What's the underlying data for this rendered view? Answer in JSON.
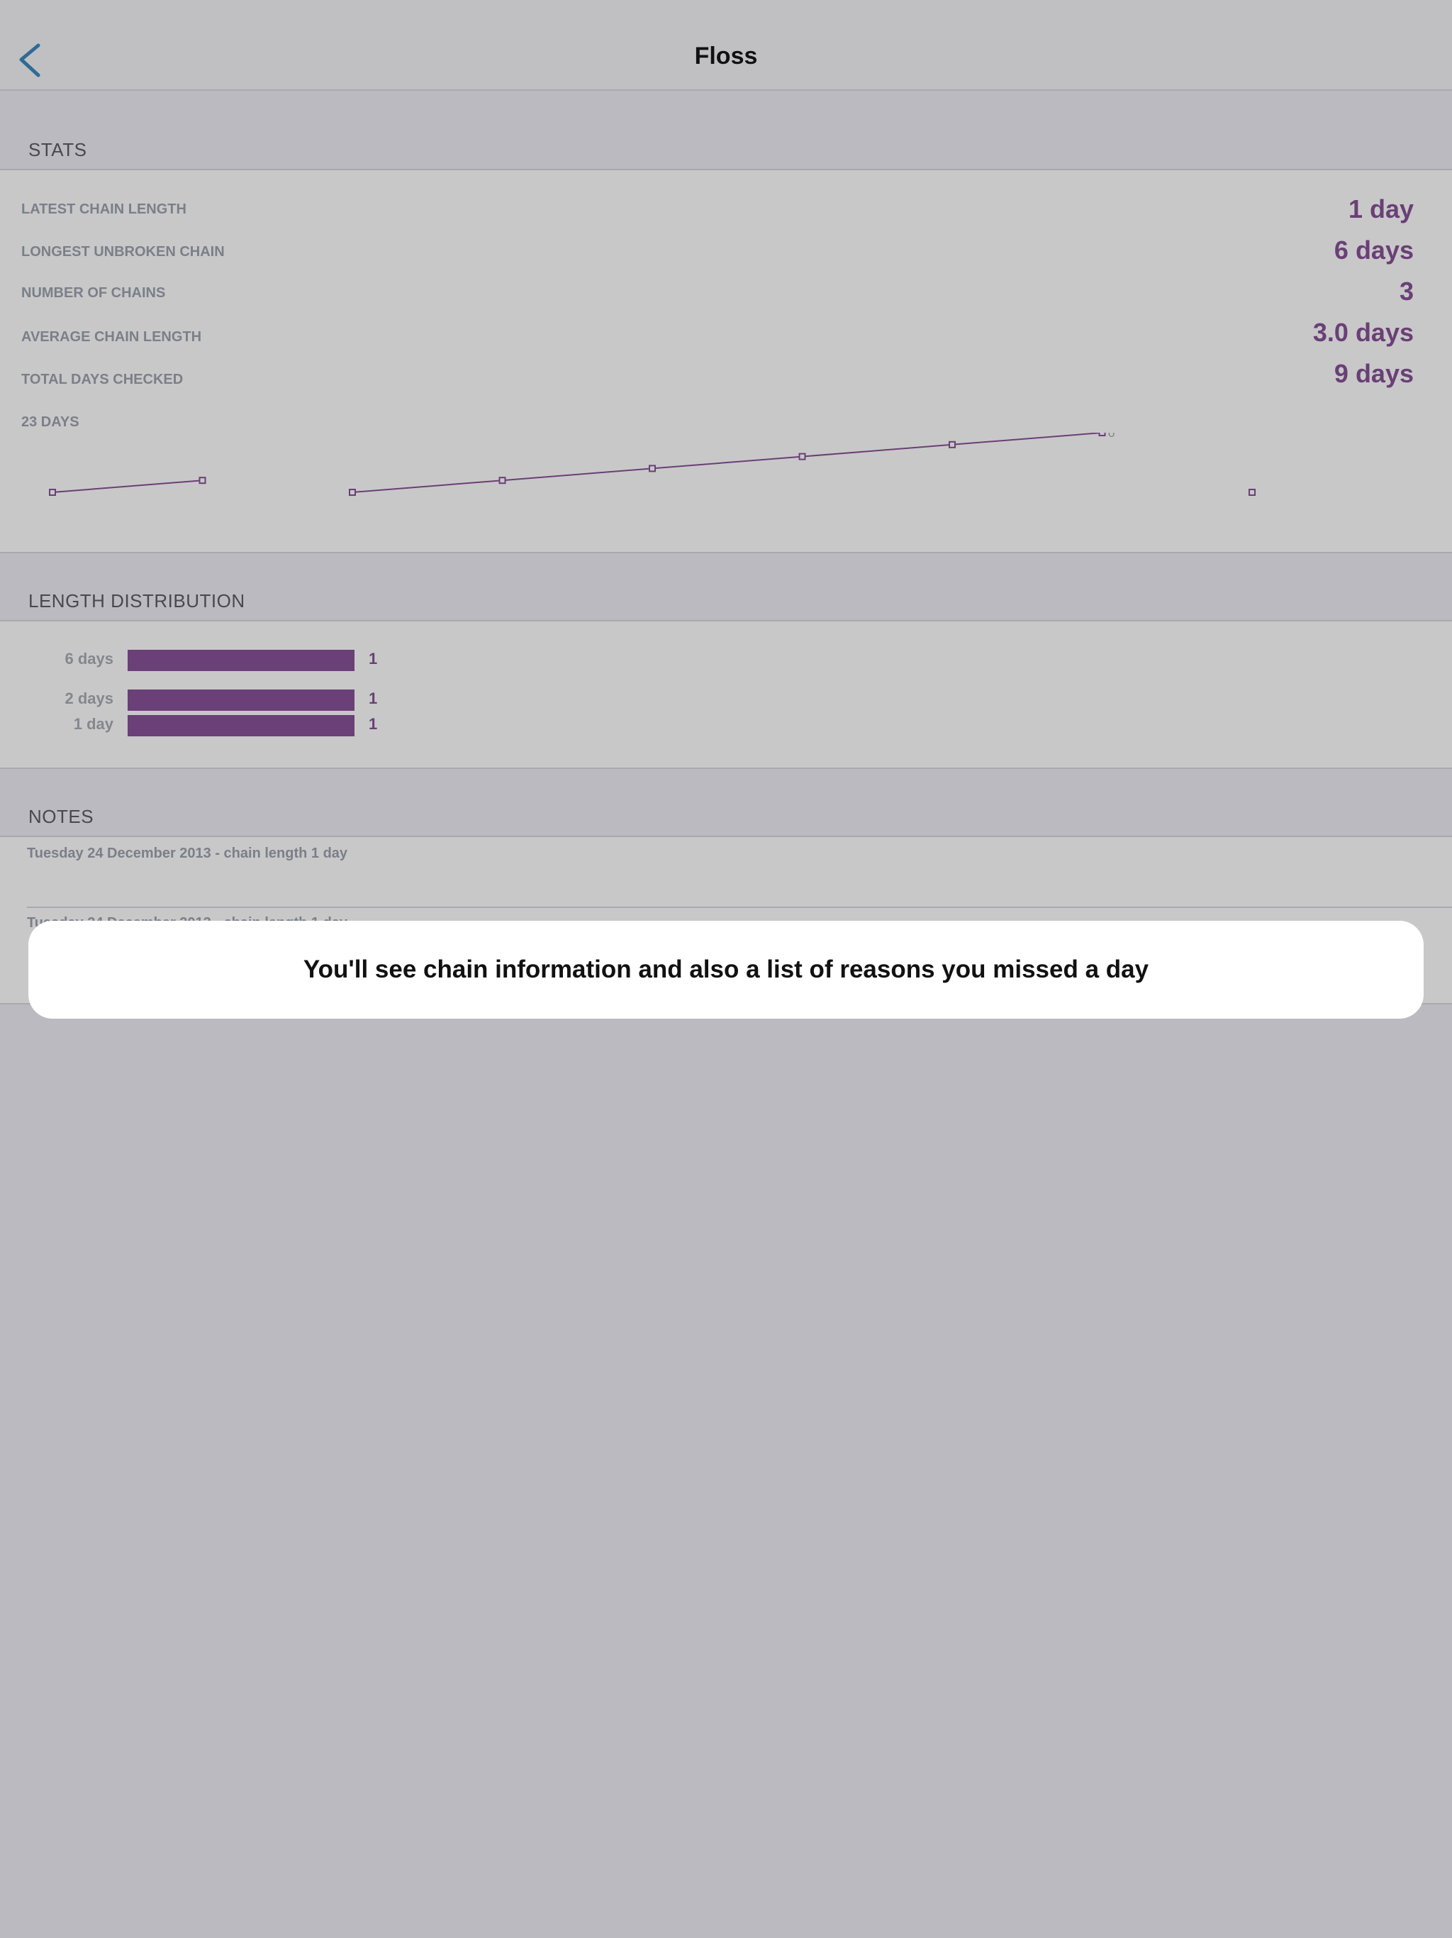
{
  "nav": {
    "title": "Floss"
  },
  "stats": {
    "header": "STATS",
    "rows": [
      {
        "label": "LATEST CHAIN LENGTH",
        "value": "1 day"
      },
      {
        "label": "LONGEST UNBROKEN CHAIN",
        "value": "6 days"
      },
      {
        "label": "NUMBER OF CHAINS",
        "value": "3"
      },
      {
        "label": "AVERAGE CHAIN LENGTH",
        "value": "3.0 days"
      },
      {
        "label": "TOTAL DAYS CHECKED",
        "value": "9 days"
      }
    ],
    "chart_label": "23 DAYS"
  },
  "chart_data": {
    "type": "line",
    "series": [
      {
        "points": [
          [
            1,
            1
          ],
          [
            2,
            2
          ]
        ]
      },
      {
        "points": [
          [
            3,
            1
          ],
          [
            4,
            2
          ],
          [
            5,
            3
          ],
          [
            6,
            4
          ],
          [
            7,
            5
          ],
          [
            8,
            6
          ]
        ]
      },
      {
        "points": [
          [
            9,
            1
          ]
        ]
      }
    ],
    "ylim": [
      0,
      6
    ],
    "peak_label": "6",
    "color": "#6a3f76"
  },
  "distribution": {
    "header": "LENGTH DISTRIBUTION",
    "rows": [
      {
        "label": "6 days",
        "count": "1"
      },
      {
        "label": "2 days",
        "count": "1"
      },
      {
        "label": "1 day",
        "count": "1"
      }
    ]
  },
  "notes": {
    "header": "NOTES",
    "items": [
      "Tuesday 24 December 2013 - chain length 1 day",
      "Tuesday 24 December 2013 - chain length 1 day"
    ]
  },
  "tooltip": {
    "text": "You'll see chain information and also a list of reasons you missed a day"
  },
  "colors": {
    "accent": "#6a3f76",
    "back": "#2f6b95",
    "background": "#bbbac0"
  }
}
